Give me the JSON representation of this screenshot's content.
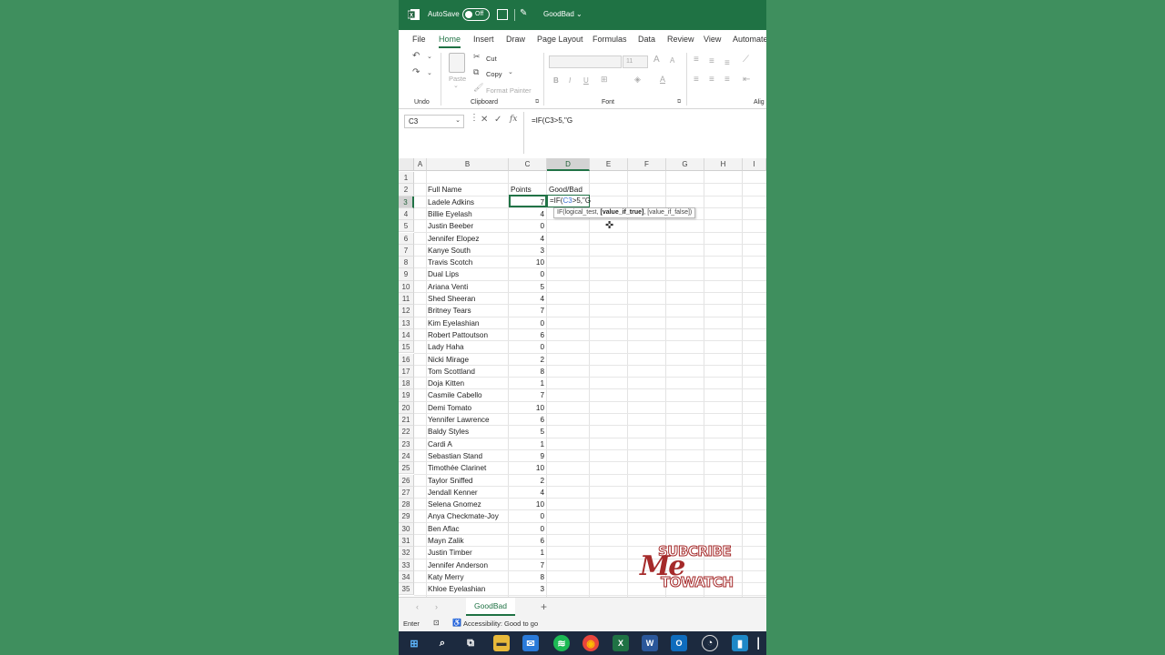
{
  "titlebar": {
    "autosave_label": "AutoSave",
    "autosave_state": "Off",
    "title": "GoodBad",
    "title_arrow": "⌄"
  },
  "ribbon_tabs": [
    "File",
    "Home",
    "Insert",
    "Draw",
    "Page Layout",
    "Formulas",
    "Data",
    "Review",
    "View",
    "Automate"
  ],
  "active_tab": "Home",
  "ribbon": {
    "undo_group": "Undo",
    "clipboard_group": "Clipboard",
    "font_group": "Font",
    "align_group": "Alig",
    "paste": "Paste",
    "cut": "Cut",
    "copy": "Copy",
    "format_painter": "Format Painter",
    "font_size": "11",
    "grow_font": "A",
    "shrink_font": "A"
  },
  "formula_bar": {
    "name_box": "C3",
    "name_box_arrow": "⌄",
    "cancel_glyph": "✕",
    "enter_glyph": "✓",
    "fx_glyph": "fx",
    "formula": "=IF(C3>5,\"G"
  },
  "columns": [
    "A",
    "B",
    "C",
    "D",
    "E",
    "F",
    "G",
    "H",
    "I"
  ],
  "row_numbers": [
    "1",
    "2",
    "3",
    "4",
    "5",
    "6",
    "7",
    "8",
    "9",
    "10",
    "11",
    "12",
    "13",
    "14",
    "15",
    "16",
    "17",
    "18",
    "19",
    "20",
    "21",
    "22",
    "23",
    "24",
    "25",
    "26",
    "27",
    "28",
    "29",
    "30",
    "31",
    "32",
    "33",
    "34",
    "35"
  ],
  "table": {
    "headers": {
      "name": "Full Name",
      "points": "Points",
      "result": "Good/Bad"
    },
    "rows": [
      {
        "name": "Ladele Adkins",
        "points": "7"
      },
      {
        "name": "Billie Eyelash",
        "points": "4"
      },
      {
        "name": "Justin Beeber",
        "points": "0"
      },
      {
        "name": "Jennifer Elopez",
        "points": "4"
      },
      {
        "name": "Kanye South",
        "points": "3"
      },
      {
        "name": "Travis Scotch",
        "points": "10"
      },
      {
        "name": "Dual Lips",
        "points": "0"
      },
      {
        "name": "Ariana Venti",
        "points": "5"
      },
      {
        "name": "Shed Sheeran",
        "points": "4"
      },
      {
        "name": "Britney Tears",
        "points": "7"
      },
      {
        "name": "Kim Eyelashian",
        "points": "0"
      },
      {
        "name": "Robert Pattoutson",
        "points": "6"
      },
      {
        "name": "Lady Haha",
        "points": "0"
      },
      {
        "name": "Nicki Mirage",
        "points": "2"
      },
      {
        "name": "Tom Scottland",
        "points": "8"
      },
      {
        "name": "Doja Kitten",
        "points": "1"
      },
      {
        "name": "Casmile Cabello",
        "points": "7"
      },
      {
        "name": "Demi Tomato",
        "points": "10"
      },
      {
        "name": "Yennifer Lawrence",
        "points": "6"
      },
      {
        "name": "Baldy Styles",
        "points": "5"
      },
      {
        "name": "Cardi A",
        "points": "1"
      },
      {
        "name": "Sebastian Stand",
        "points": "9"
      },
      {
        "name": "Timothée Clarinet",
        "points": "10"
      },
      {
        "name": "Taylor Sniffed",
        "points": "2"
      },
      {
        "name": "Jendall Kenner",
        "points": "4"
      },
      {
        "name": "Selena Gnomez",
        "points": "10"
      },
      {
        "name": "Anya Checkmate-Joy",
        "points": "0"
      },
      {
        "name": "Ben Aflac",
        "points": "0"
      },
      {
        "name": "Mayn Zalik",
        "points": "6"
      },
      {
        "name": "Justin Timber",
        "points": "1"
      },
      {
        "name": "Jennifer Anderson",
        "points": "7"
      },
      {
        "name": "Katy Merry",
        "points": "8"
      },
      {
        "name": "Khloe Eyelashian",
        "points": "3"
      }
    ]
  },
  "edit_cell": {
    "prefix": "=IF(",
    "ref": "C3",
    "suffix": ">5,\"G"
  },
  "tooltip": {
    "fn": "IF(",
    "arg1": "logical_test, ",
    "arg2": "[value_if_true]",
    "arg3": ", [value_if_false])"
  },
  "watermark": {
    "top": "SUBCRIBE",
    "script": "Me",
    "bottom": "TOWATCH"
  },
  "sheet_tabs": {
    "nav_prev": "‹",
    "nav_next": "›",
    "active": "GoodBad",
    "add": "+"
  },
  "statusbar": {
    "mode": "Enter",
    "accessibility": "Accessibility: Good to go"
  },
  "colors": {
    "excel_green": "#1f7244",
    "background": "#3f8f5e",
    "taskbar": "#1c2a3f"
  }
}
